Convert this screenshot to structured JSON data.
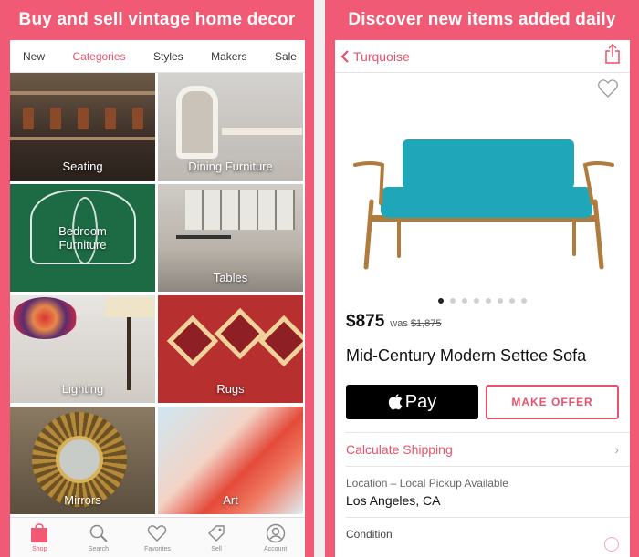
{
  "left_screen": {
    "headline": "Buy and sell vintage home decor",
    "tabs": [
      {
        "label": "New",
        "active": false
      },
      {
        "label": "Categories",
        "active": true
      },
      {
        "label": "Styles",
        "active": false
      },
      {
        "label": "Makers",
        "active": false
      },
      {
        "label": "Sale",
        "active": false
      }
    ],
    "categories": [
      {
        "label": "Seating"
      },
      {
        "label": "Dining Furniture"
      },
      {
        "label": "Bedroom\nFurniture"
      },
      {
        "label": "Tables"
      },
      {
        "label": "Lighting"
      },
      {
        "label": "Rugs"
      },
      {
        "label": "Mirrors"
      },
      {
        "label": "Art"
      }
    ],
    "bottom_nav": [
      {
        "label": "Shop",
        "icon": "shopping-bag-icon",
        "active": true
      },
      {
        "label": "Search",
        "icon": "search-icon",
        "active": false
      },
      {
        "label": "Favorites",
        "icon": "heart-icon",
        "active": false
      },
      {
        "label": "Sell",
        "icon": "tag-icon",
        "active": false
      },
      {
        "label": "Account",
        "icon": "user-icon",
        "active": false
      }
    ]
  },
  "right_screen": {
    "headline": "Discover new items added daily",
    "header": {
      "back_label": "Turquoise",
      "share_icon": "share-icon"
    },
    "product": {
      "image_count": 8,
      "active_image_index": 0,
      "price": "$875",
      "was_label": "was",
      "old_price": "$1,875",
      "title": "Mid-Century Modern Settee Sofa",
      "sofa_color": "#1fa6b8",
      "wood_color": "#b07c3e"
    },
    "buttons": {
      "apple_pay_label": "Pay",
      "make_offer_label": "MAKE OFFER"
    },
    "calculate_shipping_label": "Calculate Shipping",
    "location_label": "Location – Local Pickup Available",
    "location_value": "Los Angeles, CA",
    "condition_label": "Condition"
  },
  "colors": {
    "brand_pink": "#f05a74",
    "accent": "#e8516c"
  }
}
